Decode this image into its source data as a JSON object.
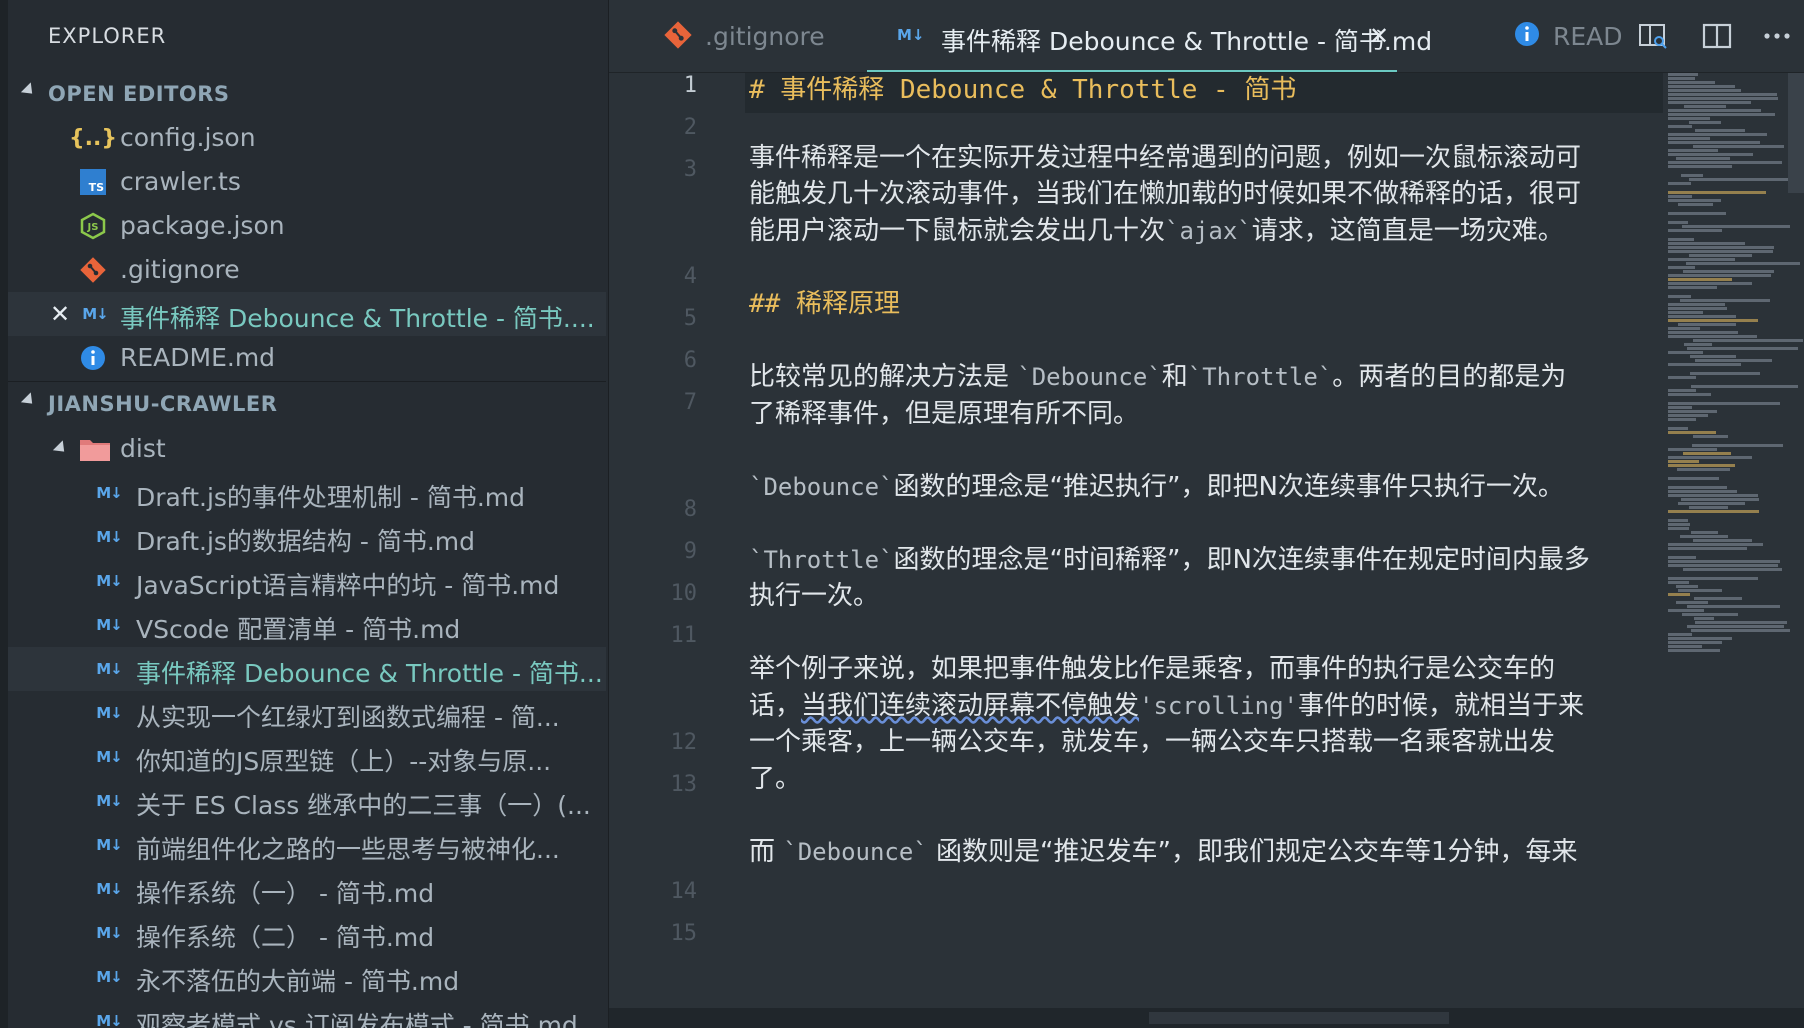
{
  "sidebar": {
    "title": "EXPLORER",
    "open_editors": {
      "label": "OPEN EDITORS",
      "items": [
        {
          "label": "config.json",
          "icon": "json-icon"
        },
        {
          "label": "crawler.ts",
          "icon": "typescript-icon",
          "icon_text": "TS"
        },
        {
          "label": "package.json",
          "icon": "nodejs-icon"
        },
        {
          "label": ".gitignore",
          "icon": "git-icon"
        },
        {
          "label": "事件稀释 Debounce & Throttle - 简书....",
          "icon": "markdown-icon",
          "icon_text": "M↓",
          "active": true
        },
        {
          "label": "README.md",
          "icon": "info-icon"
        }
      ]
    },
    "project": {
      "label": "JIANSHU-CRAWLER",
      "folder": {
        "label": "dist",
        "icon": "folder-icon"
      },
      "files": [
        "Draft.js的事件处理机制 - 简书.md",
        "Draft.js的数据结构 - 简书.md",
        "JavaScript语言精粹中的坑 - 简书.md",
        "VScode 配置清单 - 简书.md",
        "事件稀释 Debounce & Throttle - 简书...",
        "从实现一个红绿灯到函数式编程 - 简...",
        "你知道的JS原型链（上）--对象与原...",
        "关于 ES Class 继承中的二三事（一）(...",
        "前端组件化之路的一些思考与被神化...",
        "操作系统（一） - 简书.md",
        "操作系统（二） - 简书.md",
        "永不落伍的大前端 - 简书.md",
        "观察者模式 vs 订阅发布模式 - 简书.md"
      ],
      "md_icon_text": "M↓"
    }
  },
  "tabs": [
    {
      "label": ".gitignore",
      "icon": "git-icon"
    },
    {
      "label": "事件稀释 Debounce & Throttle - 简书.md",
      "icon": "markdown-icon",
      "icon_text": "M↓",
      "close": "✕"
    },
    {
      "label": "READ",
      "icon": "info-icon"
    }
  ],
  "editor": {
    "line_numbers": [
      "1",
      "2",
      "3",
      "4",
      "5",
      "6",
      "7",
      "8",
      "9",
      "10",
      "11",
      "12",
      "13",
      "14",
      "15"
    ],
    "lines": {
      "l1": "# 事件稀释 Debounce & Throttle - 简书",
      "l3a": "事件稀释是一个在实际开发过程中经常遇到的问题，例如一次鼠标滚动可",
      "l3b": "能触发几十次滚动事件，当我们在懒加载的时候如果不做稀释的话，很可",
      "l3c_1": "能用户滚动一下鼠标就会发出几十次",
      "l3c_code": "`ajax`",
      "l3c_2": "请求，这简直是一场灾难。",
      "l5": "## 稀释原理",
      "l7a_1": "比较常见的解决方法是 ",
      "l7a_code1": "`Debounce`",
      "l7a_2": "和",
      "l7a_code2": "`Throttle`",
      "l7a_3": "。两者的目的都是为",
      "l7b": "了稀释事件，但是原理有所不同。",
      "l9_code": "`Debounce`",
      "l9_text": "函数的理念是“推迟执行”，即把N次连续事件只执行一次。",
      "l11_code": "`Throttle`",
      "l11_text": "函数的理念是“时间稀释”，即N次连续事件在规定时间内最多",
      "l11b": "执行一次。",
      "l13a": "举个例子来说，如果把事件触发比作是乘客，而事件的执行是公交车的",
      "l13b_1": "话，",
      "l13b_sq": "当我们连续滚动屏幕不停触发",
      "l13b_code": "'scrolling'",
      "l13b_2": "事件的时候，就相当于来",
      "l13c": "一个乘客，上一辆公交车，就发车，一辆公交车只搭载一名乘客就出发",
      "l13d": "了。",
      "l15_1": "而 ",
      "l15_code": "`Debounce`",
      "l15_2": " 函数则是“推迟发车”，即我们规定公交车等1分钟，每来"
    }
  },
  "colors": {
    "accent": "#6bc9c2",
    "heading": "#e9bd5c",
    "markdown_icon": "#5aa6ea"
  }
}
